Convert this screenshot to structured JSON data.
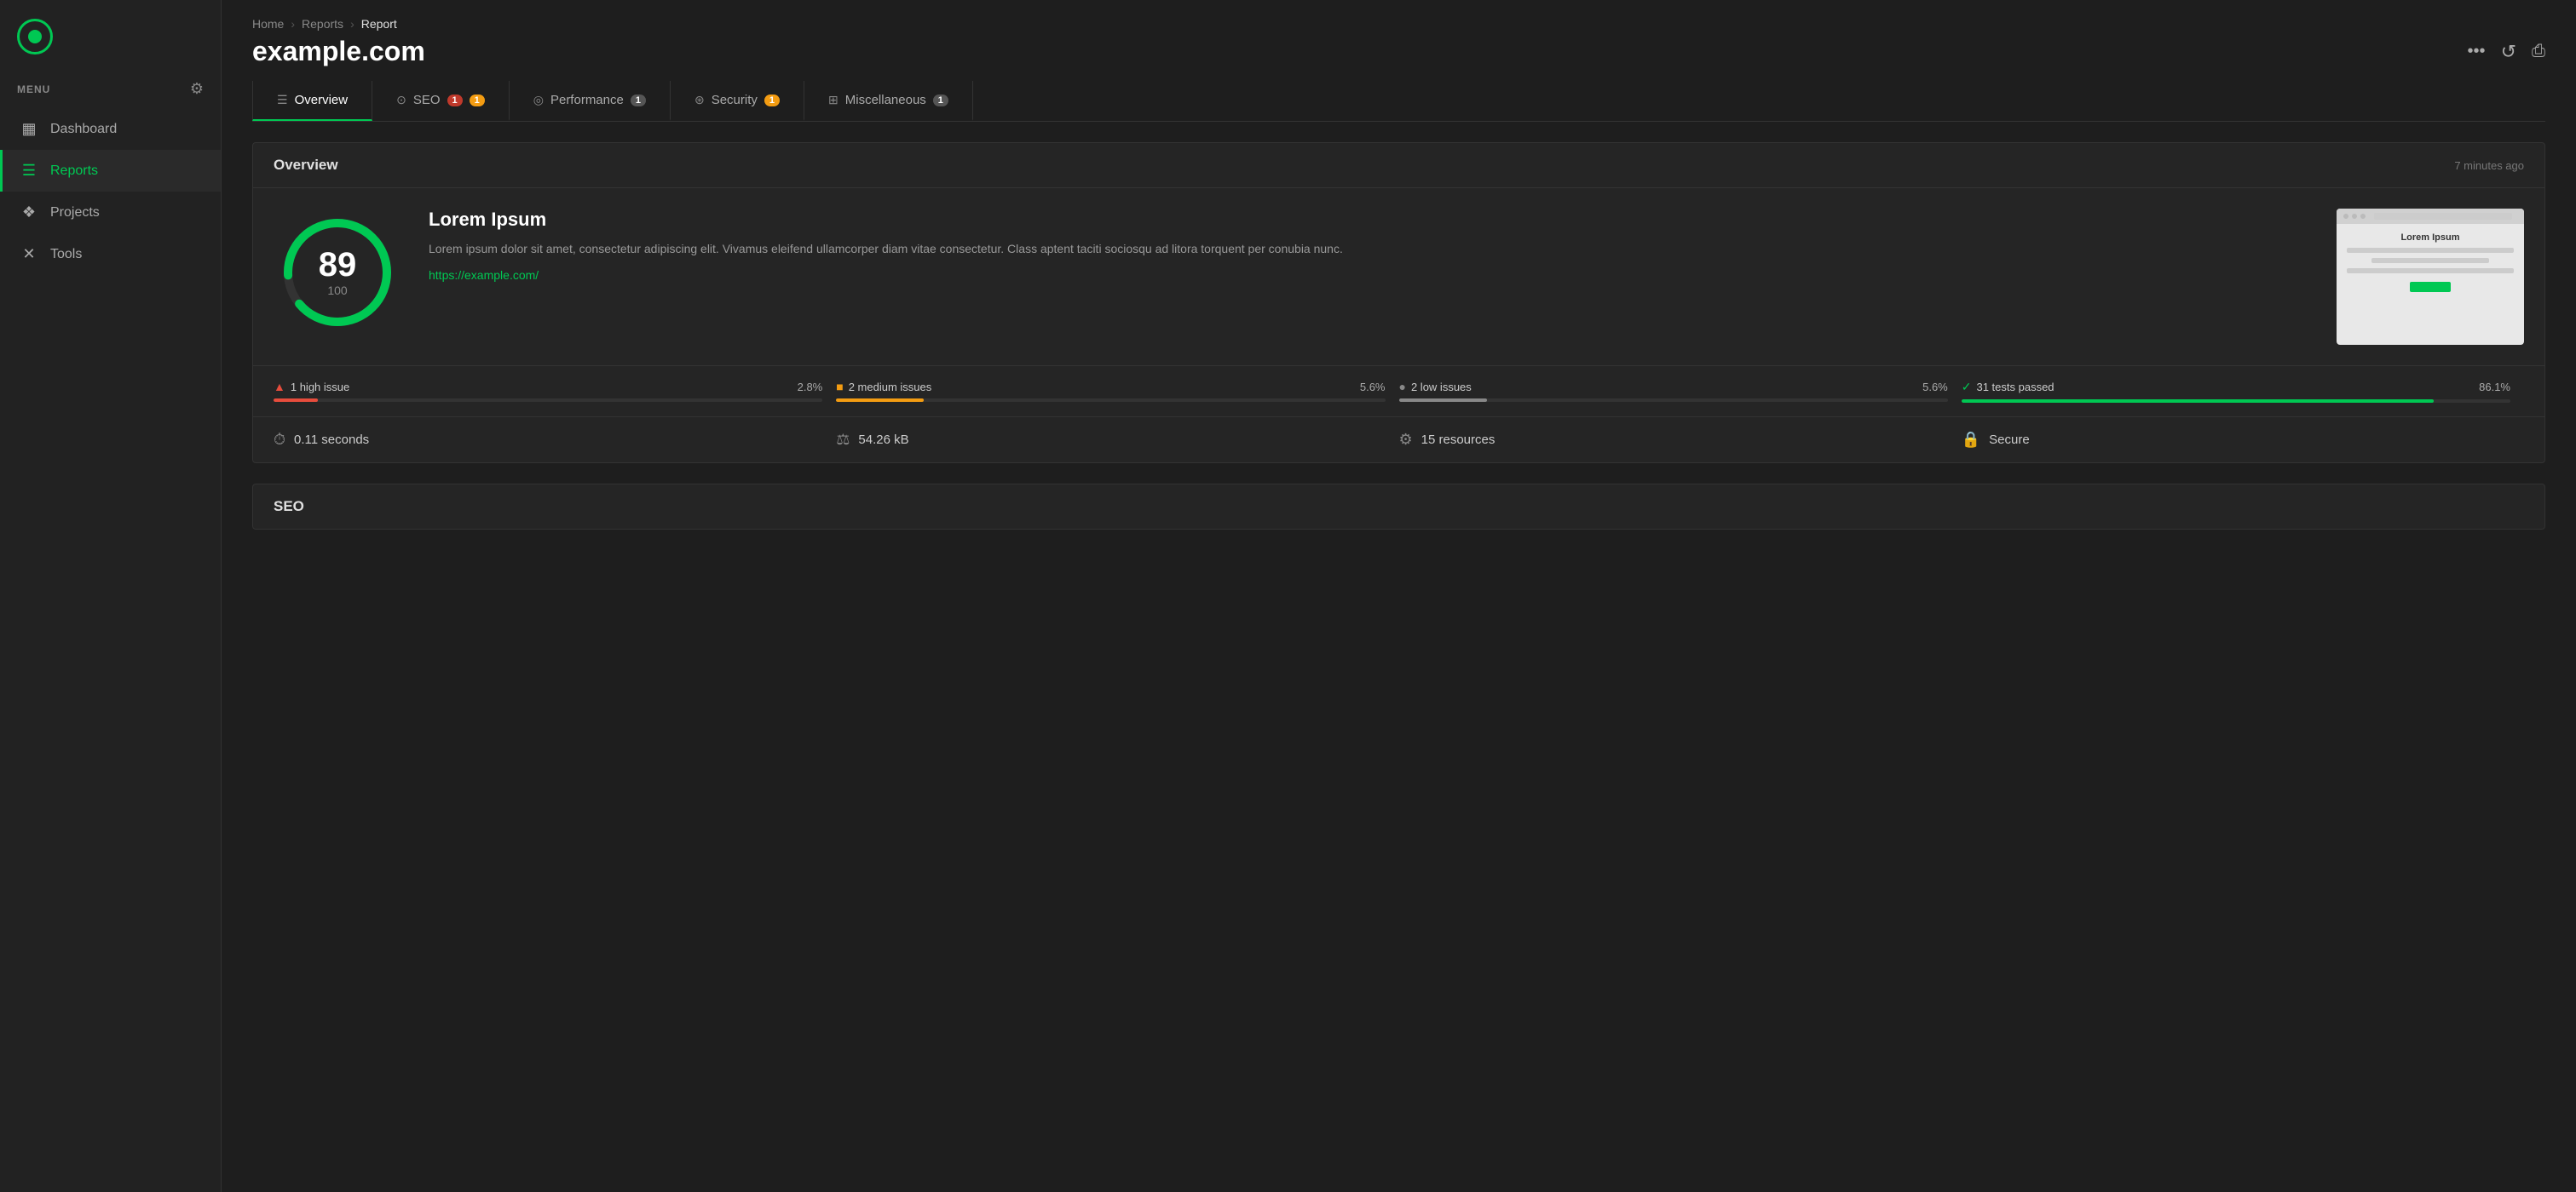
{
  "sidebar": {
    "logo_alt": "App Logo",
    "menu_label": "MENU",
    "settings_icon": "⚙",
    "nav_items": [
      {
        "id": "dashboard",
        "label": "Dashboard",
        "icon": "▦",
        "active": false
      },
      {
        "id": "reports",
        "label": "Reports",
        "icon": "☰",
        "active": true
      },
      {
        "id": "projects",
        "label": "Projects",
        "icon": "❖",
        "active": false
      },
      {
        "id": "tools",
        "label": "Tools",
        "icon": "✕",
        "active": false
      }
    ]
  },
  "header": {
    "breadcrumb": {
      "home": "Home",
      "reports": "Reports",
      "current": "Report"
    },
    "page_title": "example.com",
    "actions": {
      "more": "•••",
      "refresh": "↺",
      "print": "⎙"
    }
  },
  "tabs": [
    {
      "id": "overview",
      "label": "Overview",
      "icon": "☰",
      "badge": null,
      "active": true
    },
    {
      "id": "seo",
      "label": "SEO",
      "icon": "⊙",
      "badge_red": "1",
      "badge_yellow": "1",
      "active": false
    },
    {
      "id": "performance",
      "label": "Performance",
      "icon": "◎",
      "badge_gray": "1",
      "active": false
    },
    {
      "id": "security",
      "label": "Security",
      "icon": "⊛",
      "badge_yellow": "1",
      "active": false
    },
    {
      "id": "miscellaneous",
      "label": "Miscellaneous",
      "icon": "⊞",
      "badge_gray": "1",
      "active": false
    }
  ],
  "overview": {
    "title": "Overview",
    "timestamp": "7 minutes ago",
    "score": "89",
    "score_max": "100",
    "site_name": "Lorem Ipsum",
    "description": "Lorem ipsum dolor sit amet, consectetur adipiscing elit. Vivamus eleifend ullamcorper diam vitae consectetur. Class aptent taciti sociosqu ad litora torquent per conubia nunc.",
    "url": "https://example.com/",
    "preview_title": "Lorem Ipsum",
    "issues": [
      {
        "id": "high",
        "label": "1 high issue",
        "pct": "2.8%",
        "fill_pct": 8,
        "color": "#e74c3c",
        "dot_color": "red"
      },
      {
        "id": "medium",
        "label": "2 medium issues",
        "pct": "5.6%",
        "fill_pct": 16,
        "color": "#f39c12",
        "dot_color": "yellow"
      },
      {
        "id": "low",
        "label": "2 low issues",
        "pct": "5.6%",
        "fill_pct": 16,
        "color": "#888888",
        "dot_color": "gray"
      },
      {
        "id": "passed",
        "label": "31 tests passed",
        "pct": "86.1%",
        "fill_pct": 86,
        "color": "#00c853",
        "dot_color": "green"
      }
    ],
    "stats": [
      {
        "id": "time",
        "icon": "⏱",
        "value": "0.11 seconds"
      },
      {
        "id": "size",
        "icon": "⚖",
        "value": "54.26 kB"
      },
      {
        "id": "resources",
        "icon": "⚙",
        "value": "15 resources"
      },
      {
        "id": "security",
        "icon": "🔒",
        "value": "Secure"
      }
    ]
  },
  "seo_section": {
    "title": "SEO"
  }
}
